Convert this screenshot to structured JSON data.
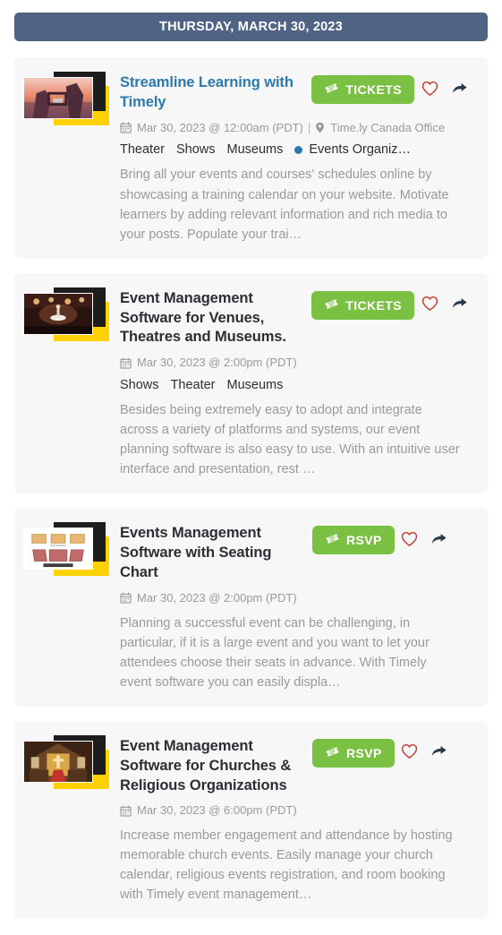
{
  "day_header": {
    "label": "THURSDAY, MARCH 30, 2023"
  },
  "colors": {
    "header_bar": "#4f6385",
    "cta_green": "#7ac143",
    "title_link": "#2a7ab0",
    "heart_red": "#c0392b",
    "share_dark": "#2b3a4a",
    "card_bg": "#f7f7f7",
    "muted_text": "#9a9a9a",
    "tag_dot": "#2a7ab0",
    "accent_yellow": "#ffd100"
  },
  "events": [
    {
      "title": "Streamline Learning with Timely",
      "title_style": "link",
      "date": "Mar 30, 2023 @ 12:00am (PDT)",
      "separator": "|",
      "venue": "Time.ly Canada Office",
      "has_venue": true,
      "tags": [
        "Theater",
        "Shows",
        "Museums"
      ],
      "dotted_tag": "Events Organiz…",
      "cta_label": "TICKETS",
      "description": "Bring all your events and courses' schedules online by showcasing a training calendar on your website. Motivate learners by adding relevant information and rich media to your posts. Populate your trai…",
      "thumb": "camera-hands-sunset"
    },
    {
      "title": "Event Management Software for Venues, Theatres and Museums.",
      "title_style": "plain",
      "date": "Mar 30, 2023 @ 2:00pm (PDT)",
      "has_venue": false,
      "tags": [
        "Shows",
        "Theater",
        "Museums"
      ],
      "dotted_tag": null,
      "cta_label": "TICKETS",
      "description": "Besides being extremely easy to adopt and integrate across a variety of platforms and systems, our event planning software is also easy to use. With an intuitive user interface and presentation, rest …",
      "thumb": "ballet-stage"
    },
    {
      "title": "Events Management Software with Seating Chart",
      "title_style": "plain",
      "date": "Mar 30, 2023 @ 2:00pm (PDT)",
      "has_venue": false,
      "tags": [],
      "dotted_tag": null,
      "cta_label": "RSVP",
      "description": "Planning a successful event can be challenging, in particular, if it is a large event and you want to let your attendees choose their seats in advance. With Timely event software you can easily displa…",
      "thumb": "seating-chart"
    },
    {
      "title": "Event Management Software for Churches & Religious Organizations",
      "title_style": "plain",
      "date": "Mar 30, 2023 @ 6:00pm (PDT)",
      "has_venue": false,
      "tags": [],
      "dotted_tag": null,
      "cta_label": "RSVP",
      "description": "Increase member engagement and attendance by hosting memorable church events. Easily manage your church calendar, religious events registration, and room booking with Timely event management…",
      "thumb": "church-interior"
    }
  ],
  "icons": {
    "calendar": "calendar-icon",
    "location": "location-pin-icon",
    "ticket": "ticket-icon",
    "favorite": "heart-icon",
    "share": "share-arrow-icon"
  }
}
